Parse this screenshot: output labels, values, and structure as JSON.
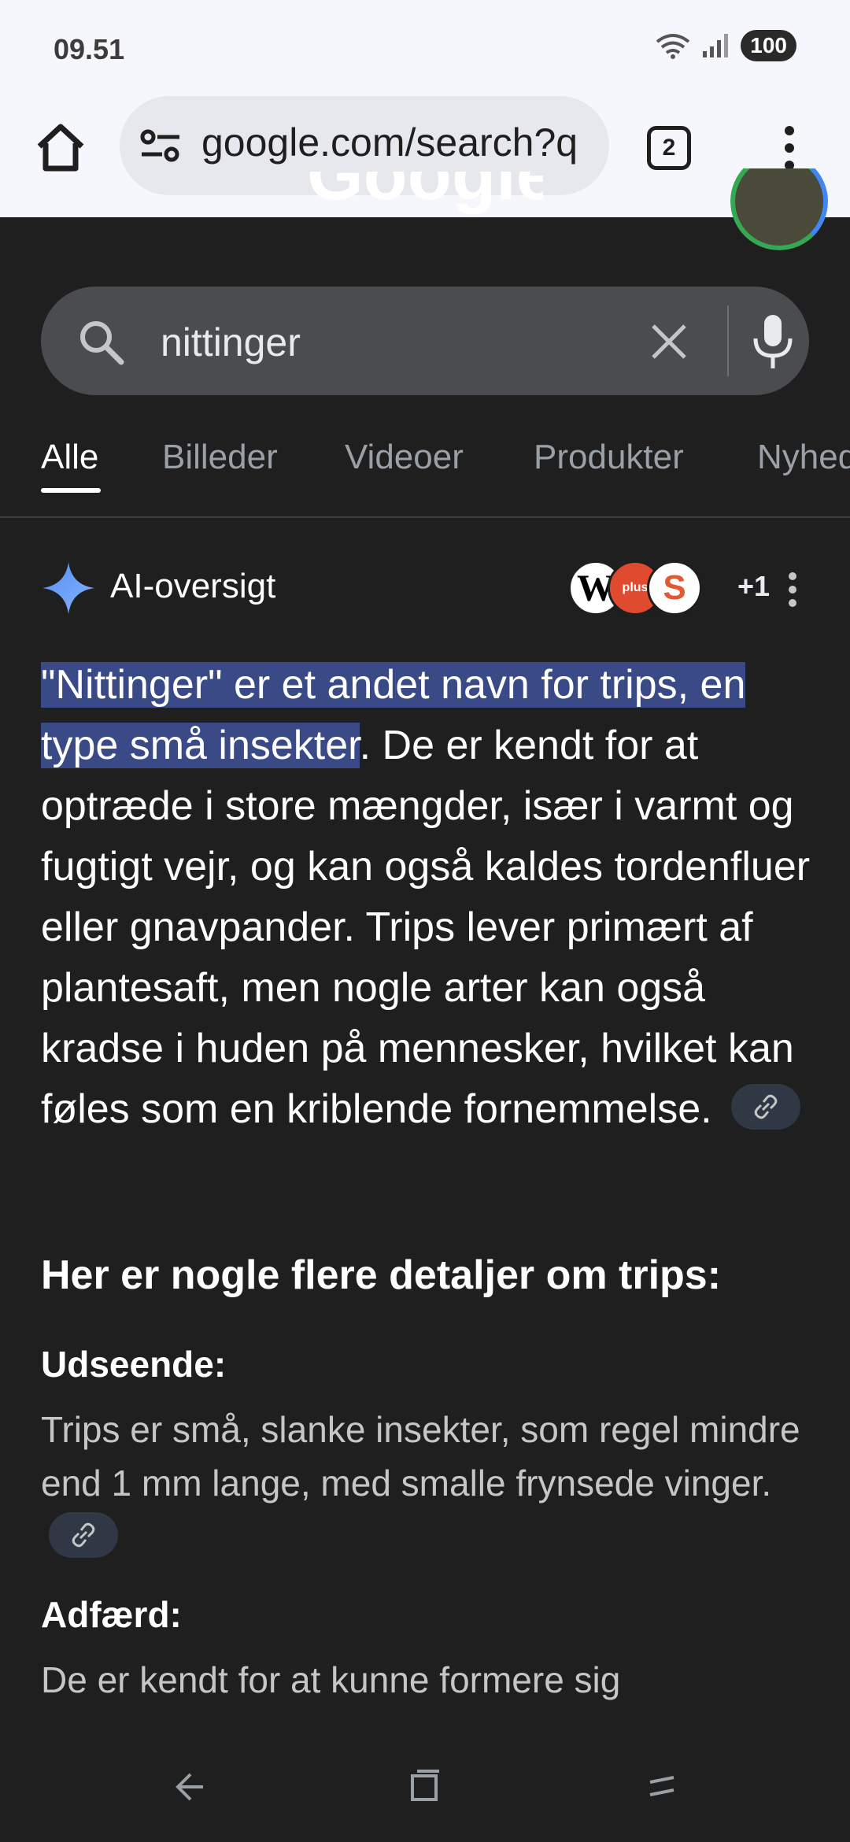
{
  "status": {
    "time": "09.51",
    "battery": "100"
  },
  "browser": {
    "url": "google.com/search?q",
    "tab_count": "2"
  },
  "search": {
    "query": "nittinger"
  },
  "tabs": [
    {
      "label": "Alle",
      "active": true
    },
    {
      "label": "Billeder"
    },
    {
      "label": "Videoer"
    },
    {
      "label": "Produkter"
    },
    {
      "label": "Nyhed"
    }
  ],
  "ai": {
    "label": "AI-oversigt",
    "sources_more": "+1",
    "answer_highlight": "\"Nittinger\" er et andet navn for trips, en type små insekter",
    "answer_rest": ". De er kendt for at optræde i store mængder, især i varmt og fugtigt vejr, og kan også kaldes tordenfluer eller gnavpander. Trips lever primært af plantesaft, men nogle arter kan også kradse i huden på mennesker, hvilket kan føles som en kriblende fornemmelse.",
    "subheading": "Her er nogle flere detaljer om trips:",
    "details": [
      {
        "title": "Udseende:",
        "text": "Trips er små, slanke insekter, som regel mindre end 1 mm lange, med smalle frynsede vinger."
      },
      {
        "title": "Adfærd:",
        "text": "De er kendt for at kunne formere sig"
      }
    ]
  },
  "icons": {
    "home": "home-icon",
    "site_info": "tune-icon",
    "menu": "more-vert-icon",
    "search": "search-icon",
    "clear": "close-icon",
    "mic": "mic-icon",
    "spark": "gemini-spark-icon",
    "link": "link-icon",
    "back": "back-icon",
    "recents": "recents-icon",
    "home_nav": "home-nav-icon"
  },
  "colors": {
    "highlight": "#394a86",
    "background": "#1f1f1f",
    "chrome": "#f6f7fc"
  }
}
